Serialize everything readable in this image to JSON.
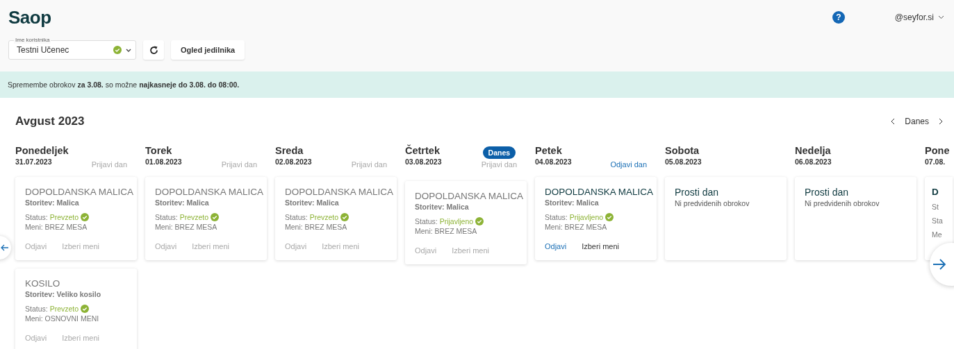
{
  "logo": "Saop",
  "help": "?",
  "user": {
    "email": "@seyfor.si"
  },
  "user_select": {
    "label": "Ime koristnika",
    "value": "Testni Učenec",
    "verified": true
  },
  "menu_button": "Ogled jedilnika",
  "notice": "Spremembe obrokov **za 3.08.** so možne **najkasneje do 3.08. do 08:00.**",
  "month": "Avgust 2023",
  "today_button": "Danes",
  "days": [
    {
      "name": "Ponedeljek",
      "date": "31.07.2023",
      "action": {
        "label": "Prijavi dan",
        "disabled": true
      },
      "cards": [
        {
          "kind": "meal",
          "title": "DOPOLDANSKA MALICA",
          "past": true,
          "service": "Storitev: Malica",
          "status_label": "Status:",
          "status": "Prevzeto",
          "confirmed": true,
          "menu": "Meni: BREZ MESA",
          "actions": [
            {
              "kind": "primary",
              "label": "Odjavi",
              "disabled": true
            },
            {
              "kind": "secondary",
              "label": "Izberi meni",
              "disabled": true
            }
          ]
        },
        {
          "kind": "meal",
          "title": "KOSILO",
          "past": true,
          "service": "Storitev: Veliko kosilo",
          "status_label": "Status:",
          "status": "Prevzeto",
          "confirmed": true,
          "menu": "Meni: OSNOVNI MENI",
          "actions": [
            {
              "kind": "primary",
              "label": "Odjavi",
              "disabled": true
            },
            {
              "kind": "secondary",
              "label": "Izberi meni",
              "disabled": true
            }
          ]
        }
      ]
    },
    {
      "name": "Torek",
      "date": "01.08.2023",
      "action": {
        "label": "Prijavi dan",
        "disabled": true
      },
      "cards": [
        {
          "kind": "meal",
          "title": "DOPOLDANSKA MALICA",
          "past": true,
          "service": "Storitev: Malica",
          "status_label": "Status:",
          "status": "Prevzeto",
          "confirmed": true,
          "menu": "Meni: BREZ MESA",
          "actions": [
            {
              "kind": "primary",
              "label": "Odjavi",
              "disabled": true
            },
            {
              "kind": "secondary",
              "label": "Izberi meni",
              "disabled": true
            }
          ]
        }
      ]
    },
    {
      "name": "Sreda",
      "date": "02.08.2023",
      "action": {
        "label": "Prijavi dan",
        "disabled": true
      },
      "cards": [
        {
          "kind": "meal",
          "title": "DOPOLDANSKA MALICA",
          "past": true,
          "service": "Storitev: Malica",
          "status_label": "Status:",
          "status": "Prevzeto",
          "confirmed": true,
          "menu": "Meni: BREZ MESA",
          "actions": [
            {
              "kind": "primary",
              "label": "Odjavi",
              "disabled": true
            },
            {
              "kind": "secondary",
              "label": "Izberi meni",
              "disabled": true
            }
          ]
        }
      ]
    },
    {
      "name": "Četrtek",
      "date": "03.08.2023",
      "badge": "Danes",
      "action": {
        "label": "Prijavi dan",
        "disabled": true
      },
      "cards": [
        {
          "kind": "meal",
          "title": "DOPOLDANSKA MALICA",
          "past": true,
          "service": "Storitev: Malica",
          "status_label": "Status:",
          "status": "Prijavljeno",
          "confirmed": true,
          "menu": "Meni: BREZ MESA",
          "actions": [
            {
              "kind": "primary",
              "label": "Odjavi",
              "disabled": true
            },
            {
              "kind": "secondary",
              "label": "Izberi meni",
              "disabled": true
            }
          ]
        }
      ]
    },
    {
      "name": "Petek",
      "date": "04.08.2023",
      "action": {
        "label": "Odjavi dan",
        "disabled": false
      },
      "cards": [
        {
          "kind": "meal",
          "title": "DOPOLDANSKA MALICA",
          "past": false,
          "service": "Storitev: Malica",
          "status_label": "Status:",
          "status": "Prijavljeno",
          "confirmed": true,
          "menu": "Meni: BREZ MESA",
          "actions": [
            {
              "kind": "primary",
              "label": "Odjavi",
              "disabled": false
            },
            {
              "kind": "secondary",
              "label": "Izberi meni",
              "disabled": false
            }
          ]
        }
      ]
    },
    {
      "name": "Sobota",
      "date": "05.08.2023",
      "cards": [
        {
          "kind": "free",
          "title": "Prosti dan",
          "note": "Ni predvidenih obrokov"
        }
      ]
    },
    {
      "name": "Nedelja",
      "date": "06.08.2023",
      "cards": [
        {
          "kind": "free",
          "title": "Prosti dan",
          "note": "Ni predvidenih obrokov"
        }
      ]
    },
    {
      "name": "Pone",
      "date": "07.08.",
      "partial": true,
      "cards": [
        {
          "kind": "partial",
          "lines": [
            "D",
            "St",
            "Sta",
            "Me"
          ]
        }
      ]
    }
  ]
}
